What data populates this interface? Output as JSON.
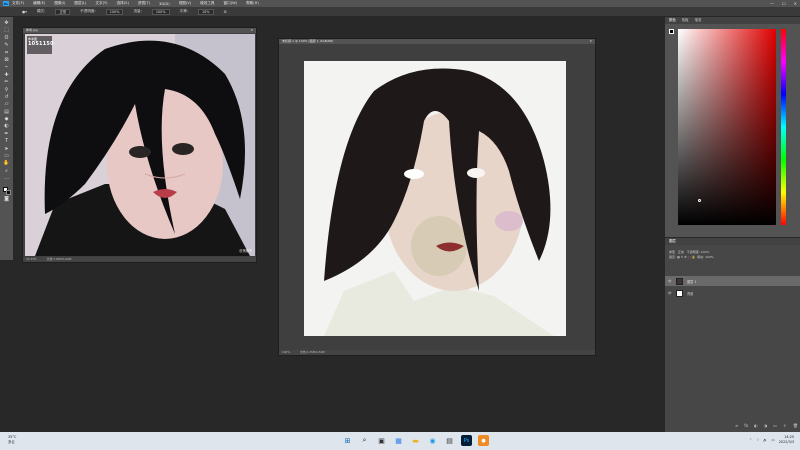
{
  "menubar": {
    "items": [
      "文件(F)",
      "编辑(E)",
      "图像(I)",
      "图层(L)",
      "文字(Y)",
      "选择(S)",
      "滤镜(T)",
      "3D(D)",
      "视图(V)",
      "增效工具",
      "窗口(W)",
      "帮助(H)"
    ]
  },
  "options": {
    "mode_label": "模式:",
    "mode_value": "正常",
    "opacity_label": "不透明度:",
    "opacity_value": "100%",
    "flow_label": "流量:",
    "flow_value": "100%",
    "smooth_label": "平滑:",
    "smooth_value": "10%"
  },
  "ref_window": {
    "title": "参考.jpg",
    "watermark_small": "参考图",
    "watermark_num": "1051150",
    "credit": "@贪睡吧",
    "status_zoom": "33.33%",
    "status_doc": "文档:3.00M/3.00M"
  },
  "paint_window": {
    "title": "未标题-1 @ 100% (图层 1, RGB/8#)",
    "status_zoom": "100%",
    "status_doc": "文档:2.25M/4.50M"
  },
  "panel": {
    "tabs": [
      "颜色",
      "色板",
      "渐变"
    ],
    "colors": {
      "hue_base": "#e00000"
    }
  },
  "layers": {
    "header": "图层",
    "kind_label": "类型",
    "blend_mode": "正常",
    "opacity_label": "不透明度:",
    "opacity_value": "100%",
    "lock_label": "锁定:",
    "fill_label": "填充:",
    "fill_value": "100%",
    "items": [
      {
        "name": "图层 1",
        "selected": true
      },
      {
        "name": "背景",
        "selected": false
      }
    ]
  },
  "taskbar": {
    "temp": "35°C",
    "weather": "多云",
    "time": "14:25",
    "date": "2022/3/3"
  }
}
